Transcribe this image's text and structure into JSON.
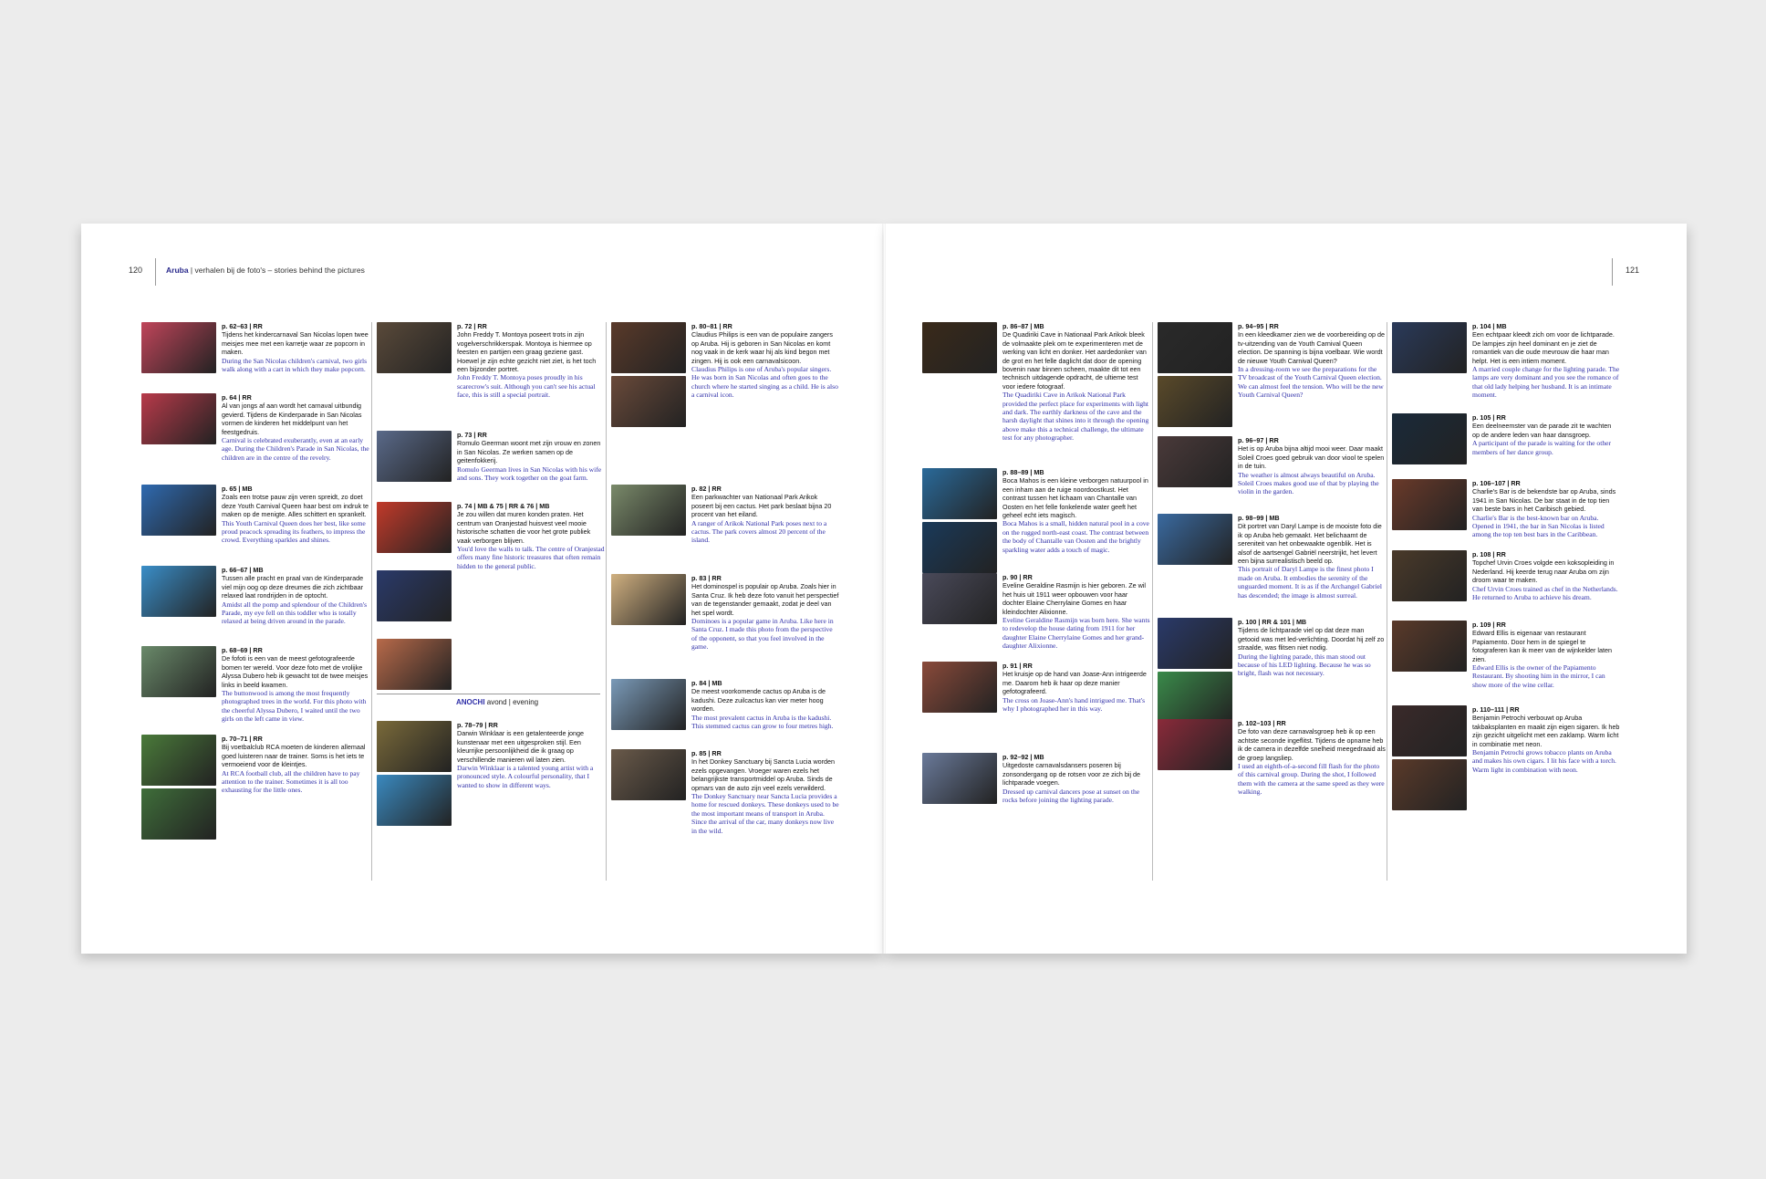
{
  "left_page": {
    "folio": "120",
    "running_head_strong": "Aruba",
    "running_head_rest": " | verhalen bij de foto's – stories behind the pictures",
    "section_label_strong": "ANOCHI",
    "section_label_rest": " avond | evening"
  },
  "right_page": {
    "folio": "121"
  },
  "entries": [
    {
      "hd": "p. 62–63 | RR",
      "nl": "Tijdens het kindercarnaval San Nicolas lopen twee meisjes mee met een karretje waar ze popcorn in maken.",
      "en": "During the San Nicolas children's carnival, two girls walk along with a cart in which they make popcorn.",
      "colors": [
        "#c0455a"
      ]
    },
    {
      "hd": "p. 64 | RR",
      "nl": "Al van jongs af aan wordt het carnaval uitbundig gevierd. Tijdens de Kinderparade in San Nicolas vormen de kinderen het middelpunt van het feestgedruis.",
      "en": "Carnival is celebrated exuberantly, even at an early age. During the Children's Parade in San Nicolas, the children are in the centre of the revelry.",
      "colors": [
        "#b83a4a"
      ]
    },
    {
      "hd": "p. 65 | MB",
      "nl": "Zoals een trotse pauw zijn veren spreidt, zo doet deze Youth Carnival Queen haar best om indruk te maken op de menigte. Alles schittert en sprankelt.",
      "en": "This Youth Carnival Queen does her best, like some proud peacock spreading its feathers, to impress the crowd. Everything sparkles and shines.",
      "colors": [
        "#2f6ab0"
      ]
    },
    {
      "hd": "p. 66–67 | MB",
      "nl": "Tussen alle pracht en praal van de Kinderparade viel mijn oog op deze dreumes die zich zichtbaar relaxed laat rondrijden in de optocht.",
      "en": "Amidst all the pomp and splendour of the Children's Parade, my eye fell on this toddler who is totally relaxed at being driven around in the parade.",
      "colors": [
        "#3a8ec8"
      ]
    },
    {
      "hd": "p. 68–69 | RR",
      "nl": "De fofoti is een van de meest gefotografeerde bomen ter wereld. Voor deze foto met de vrolijke Alyssa Dubero heb ik gewacht tot de twee meisjes links in beeld kwamen.",
      "en": "The buttonwood is among the most frequently photographed trees in the world. For this photo with the cheerful Alyssa Dubero, I waited until the two girls on the left came in view.",
      "colors": [
        "#6a8a6a"
      ]
    },
    {
      "hd": "p. 70–71 | RR",
      "nl": "Bij voetbalclub RCA moeten de kinderen allemaal goed luisteren naar de trainer. Soms is het iets te vermoeiend voor de kleintjes.",
      "en": "At RCA football club, all the children have to pay attention to the trainer. Sometimes it is all too exhausting for the little ones.",
      "colors": [
        "#4a7a3a",
        "#3f6e3a"
      ]
    },
    {
      "hd": "p. 72 | RR",
      "nl": "John Freddy T. Montoya poseert trots in zijn vogelverschrikkerspak. Montoya is hiermee op feesten en partijen een graag geziene gast. Hoewel je zijn echte gezicht niet ziet, is het toch een bijzonder portret.",
      "en": "John Freddy T. Montoya poses proudly in his scarecrow's suit. Although you can't see his actual face, this is still a special portrait.",
      "colors": [
        "#5a4a3a"
      ]
    },
    {
      "hd": "p. 73 | RR",
      "nl": "Romulo Geerman woont met zijn vrouw en zonen in San Nicolas. Ze werken samen op de geitenfokkerij.",
      "en": "Romulo Geerman lives in San Nicolas with his wife and sons. They work together on the goat farm.",
      "colors": [
        "#5a6a8a"
      ]
    },
    {
      "hd": "p. 74 | MB & 75 | RR & 76 | MB",
      "nl": "Je zou willen dat muren konden praten. Het centrum van Oranjestad huisvest veel mooie historische schatten die voor het grote publiek vaak verborgen blijven.",
      "en": "You'd love the walls to talk. The centre of Oranjestad offers many fine historic treasures that often remain hidden to the general public.",
      "colors": [
        "#c23a2a",
        "#2a3a6a",
        "#b86a4a"
      ]
    },
    {
      "hd": "p. 78–79 | RR",
      "nl": "Darwin Winklaar is een getalenteerde jonge kunstenaar met een uitgesproken stijl. Een kleurrijke persoonlijkheid die ik graag op verschillende manieren wil laten zien.",
      "en": "Darwin Winklaar is a talented young artist with a pronounced style. A colourful personality, that I wanted to show in different ways.",
      "colors": [
        "#7a6a3a",
        "#3a8ac0"
      ]
    },
    {
      "hd": "p. 80–81 | RR",
      "nl": "Claudius Philips is een van de populaire zangers op Aruba. Hij is geboren in San Nicolas en komt nog vaak in de kerk waar hij als kind begon met zingen. Hij is ook een carnavalsicoon.",
      "en": "Claudius Philips is one of Aruba's popular singers. He was born in San Nicolas and often goes to the church where he started singing as a child. He is also a carnival icon.",
      "colors": [
        "#5a3a2a",
        "#6a4a3a"
      ]
    },
    {
      "hd": "p. 82 | RR",
      "nl": "Een parkwachter van Nationaal Park Arikok poseert bij een cactus. Het park beslaat bijna 20 procent van het eiland.",
      "en": "A ranger of Arikok National Park poses next to a cactus. The park covers almost 20 percent of the island.",
      "colors": [
        "#7a8a6a"
      ]
    },
    {
      "hd": "p. 83 | RR",
      "nl": "Het dominospel is populair op Aruba. Zoals hier in Santa Cruz. Ik heb deze foto vanuit het perspectief van de tegenstander gemaakt, zodat je deel van het spel wordt.",
      "en": "Dominoes is a popular game in Aruba. Like here in Santa Cruz. I made this photo from the perspective of the opponent, so that you feel involved in the game.",
      "colors": [
        "#d0b080"
      ]
    },
    {
      "hd": "p. 84 | MB",
      "nl": "De meest voorkomende cactus op Aruba is de kadushi. Deze zuilcactus kan vier meter hoog worden.",
      "en": "The most prevalent cactus in Aruba is the kadushi. This stemmed cactus can grow to four metres high.",
      "colors": [
        "#7a9ab8"
      ]
    },
    {
      "hd": "p. 85 | RR",
      "nl": "In het Donkey Sanctuary bij Sancta Lucia worden ezels opgevangen. Vroeger waren ezels het belangrijkste transportmiddel op Aruba. Sinds de opmars van de auto zijn veel ezels verwilderd.",
      "en": "The Donkey Sanctuary near Sancta Lucia provides a home for rescued donkeys. These donkeys used to be the most important means of transport in Aruba. Since the arrival of the car, many donkeys now live in the wild.",
      "colors": [
        "#6a5a4a"
      ]
    },
    {
      "hd": "p. 86–87 | MB",
      "nl": "De Quadiriki Cave in Nationaal Park Arikok bleek de volmaakte plek om te experimenteren met de werking van licht en donker. Het aardedonker van de grot en het felle daglicht dat door de opening bovenin naar binnen scheen, maakte dit tot een technisch uitdagende opdracht, de ultieme test voor iedere fotograaf.",
      "en": "The Quadiriki Cave in Arikok National Park provided the perfect place for experiments with light and dark. The earthly darkness of the cave and the harsh daylight that shines into it through the opening above make this a technical challenge, the ultimate test for any photographer.",
      "colors": [
        "#3a2a1a"
      ]
    },
    {
      "hd": "p. 88–89 | MB",
      "nl": "Boca Mahos is een kleine verborgen natuurpool in een inham aan de ruige noordoostkust. Het contrast tussen het lichaam van Chantalle van Oosten en het felle fonkelende water geeft het geheel echt iets magisch.",
      "en": "Boca Mahos is a small, hidden natural pool in a cove on the rugged north-east coast. The contrast between the body of Chantalle van Oosten and the brightly sparkling water adds a touch of magic.",
      "colors": [
        "#2a6a9a",
        "#1a3a5a"
      ]
    },
    {
      "hd": "p. 90 | RR",
      "nl": "Eveline Geraldine Rasmijn is hier geboren. Ze wil het huis uit 1911 weer opbouwen voor haar dochter Elaine Cherrylaine Gomes en haar kleindochter Alixionne.",
      "en": "Eveline Geraldine Rasmijn was born here. She wants to redevelop the house dating from 1911 for her daughter Elaine Cherrylaine Gomes and her grand-daughter Alixionne.",
      "colors": [
        "#4a4a5a"
      ]
    },
    {
      "hd": "p. 91 | RR",
      "nl": "Het kruisje op de hand van Joase-Ann intrigeerde me. Daarom heb ik haar op deze manier gefotografeerd.",
      "en": "The cross on Joase-Ann's hand intrigued me. That's why I photographed her in this way.",
      "colors": [
        "#8a4a3a"
      ]
    },
    {
      "hd": "p. 92–92 | MB",
      "nl": "Uitgedoste carnavalsdansers poseren bij zonsondergang op de rotsen voor ze zich bij de lichtparade voegen.",
      "en": "Dressed up carnival dancers pose at sunset on the rocks before joining the lighting parade.",
      "colors": [
        "#6a7a9a"
      ]
    },
    {
      "hd": "p. 94–95 | RR",
      "nl": "In een kleedkamer zien we de voorbereiding op de tv-uitzending van de Youth Carnival Queen election. De spanning is bijna voelbaar. Wie wordt de nieuwe Youth Carnival Queen?",
      "en": "In a dressing-room we see the preparations for the TV broadcast of the Youth Carnival Queen election. We can almost feel the tension. Who will be the new Youth Carnival Queen?",
      "colors": [
        "#2a2a2a",
        "#5a4a2a"
      ]
    },
    {
      "hd": "p. 96–97 | RR",
      "nl": "Het is op Aruba bijna altijd mooi weer. Daar maakt Soleil Croes goed gebruik van door viool te spelen in de tuin.",
      "en": "The weather is almost always beautiful on Aruba. Soleil Croes makes good use of that by playing the violin in the garden.",
      "colors": [
        "#4a3a3a"
      ]
    },
    {
      "hd": "p. 98–99 | MB",
      "nl": "Dit portret van Daryl Lampe is de mooiste foto die ik op Aruba heb gemaakt. Het belichaamt de sereniteit van het onbewaakte ogenblik. Het is alsof de aartsengel Gabriël neerstrijkt, het levert een bijna surrealistisch beeld op.",
      "en": "This portrait of Daryl Lampe is the finest photo I made on Aruba. It embodies the serenity of the unguarded moment. It is as if the Archangel Gabriel has descended; the image is almost surreal.",
      "colors": [
        "#3a6aa0"
      ]
    },
    {
      "hd": "p. 100 | RR & 101 | MB",
      "nl": "Tijdens de lichtparade viel op dat deze man getooid was met led-verlichting. Doordat hij zelf zo straalde, was flitsen niet nodig.",
      "en": "During the lighting parade, this man stood out because of his LED lighting. Because he was so bright, flash was not necessary.",
      "colors": [
        "#2a3a6a",
        "#3a8a4a"
      ]
    },
    {
      "hd": "p. 102–103 | RR",
      "nl": "De foto van deze carnavalsgroep heb ik op een achtste seconde ingeflitst. Tijdens de opname heb ik de camera in dezelfde snelheid meegedraaid als de groep langsliep.",
      "en": "I used an eighth-of-a-second fill flash for the photo of this carnival group. During the shot, I followed them with the camera at the same speed as they were walking.",
      "colors": [
        "#8a2a3a"
      ]
    },
    {
      "hd": "p. 104 | MB",
      "nl": "Een echtpaar kleedt zich om voor de lichtparade. De lampjes zijn heel dominant en je ziet de romantiek van die oude mevrouw die haar man helpt. Het is een intiem moment.",
      "en": "A married couple change for the lighting parade. The lamps are very dominant and you see the romance of that old lady helping her husband. It is an intimate moment.",
      "colors": [
        "#2a3a5a"
      ]
    },
    {
      "hd": "p. 105 | RR",
      "nl": "Een deelneemster van de parade zit te wachten op de andere leden van haar dansgroep.",
      "en": "A participant of the parade is waiting for the other members of her dance group.",
      "colors": [
        "#1a2a3a"
      ]
    },
    {
      "hd": "p. 106–107 | RR",
      "nl": "Charlie's Bar is de bekendste bar op Aruba, sinds 1941 in San Nicolas. De bar staat in de top tien van beste bars in het Caribisch gebied.",
      "en": "Charlie's Bar is the best-known bar on Aruba. Opened in 1941, the bar in San Nicolas is listed among the top ten best bars in the Caribbean.",
      "colors": [
        "#6a3a2a"
      ]
    },
    {
      "hd": "p. 108 | RR",
      "nl": "Topchef Urvin Croes volgde een koksopleiding in Nederland. Hij keerde terug naar Aruba om zijn droom waar te maken.",
      "en": "Chef Urvin Croes trained as chef in the Netherlands. He returned to Aruba to achieve his dream.",
      "colors": [
        "#4a3a2a"
      ]
    },
    {
      "hd": "p. 109 | RR",
      "nl": "Edward Ellis is eigenaar van restaurant Papiamento. Door hem in de spiegel te fotograferen kan ik meer van de wijnkelder laten zien.",
      "en": "Edward Ellis is the owner of the Papiamento Restaurant. By shooting him in the mirror, I can show more of the wine cellar.",
      "colors": [
        "#5a3a2a"
      ]
    },
    {
      "hd": "p. 110–111 | RR",
      "nl": "Benjamin Petrochi verbouwt op Aruba takbaksplanten en maakt zijn eigen sigaren. Ik heb zijn gezicht uitgelicht met een zaklamp. Warm licht in combinatie met neon.",
      "en": "Benjamin Petrochi grows tobacco plants on Aruba and makes his own cigars. I lit his face with a torch. Warm light in combination with neon.",
      "colors": [
        "#3a2a2a",
        "#5a3a2a"
      ]
    }
  ]
}
